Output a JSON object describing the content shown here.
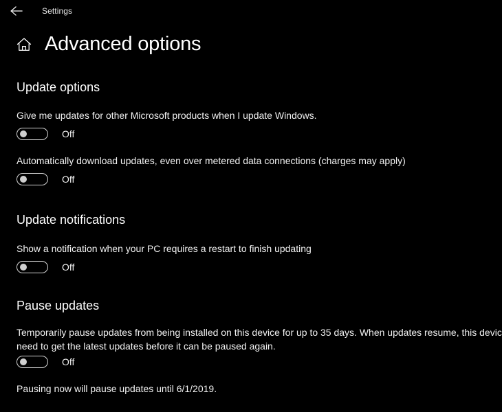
{
  "titlebar": {
    "back_label": "Back",
    "back_icon": "arrow-left-icon",
    "app_name": "Settings"
  },
  "header": {
    "home_icon": "home-icon",
    "title": "Advanced options"
  },
  "colors": {
    "background": "#000000",
    "text": "#ffffff",
    "secondary_text": "#f2f2f2",
    "toggle_border": "#d6d6d6",
    "toggle_knob": "#cfcfcf"
  },
  "sections": [
    {
      "heading": "Update options",
      "settings": [
        {
          "description": "Give me updates for other Microsoft products when I update Windows.",
          "toggle_state": "Off"
        },
        {
          "description": "Automatically download updates, even over metered data connections (charges may apply)",
          "toggle_state": "Off"
        }
      ]
    },
    {
      "heading": "Update notifications",
      "settings": [
        {
          "description": "Show a notification when your PC requires a restart to finish updating",
          "toggle_state": "Off"
        }
      ]
    },
    {
      "heading": "Pause updates",
      "settings": [
        {
          "description": "Temporarily pause updates from being installed on this device for up to 35 days. When updates resume, this device will need to get the latest updates before it can be paused again.",
          "toggle_state": "Off"
        }
      ],
      "footnote": "Pausing now will pause updates until 6/1/2019."
    }
  ]
}
